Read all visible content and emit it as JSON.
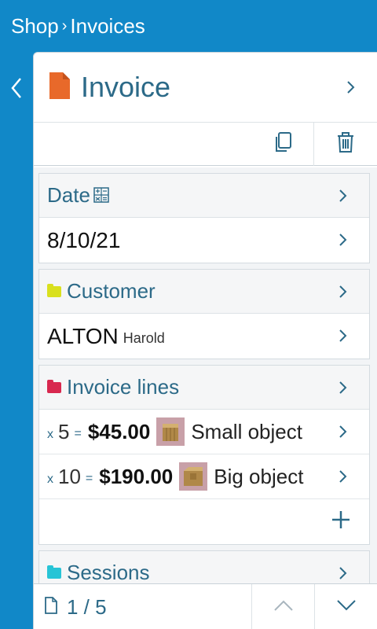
{
  "breadcrumb": {
    "parent": "Shop",
    "separator": "›",
    "current": "Invoices"
  },
  "header": {
    "title": "Invoice",
    "icon": "document-icon",
    "icon_color": "#e8692a"
  },
  "toolbar": {
    "copy_icon": "copy-icon",
    "delete_icon": "trash-icon"
  },
  "sections": {
    "date": {
      "label": "Date",
      "value": "8/10/21"
    },
    "customer": {
      "label": "Customer",
      "last_name": "ALTON",
      "first_name": "Harold",
      "folder_color": "#d9e01e"
    },
    "invoice_lines": {
      "label": "Invoice lines",
      "folder_color": "#d8284f",
      "lines": [
        {
          "x": "x",
          "qty": "5",
          "eq": "=",
          "price": "$45.00",
          "name": "Small object"
        },
        {
          "x": "x",
          "qty": "10",
          "eq": "=",
          "price": "$190.00",
          "name": "Big object"
        }
      ]
    },
    "sessions": {
      "label": "Sessions",
      "folder_color": "#27c4d6"
    }
  },
  "pager": {
    "text": "1 / 5"
  },
  "colors": {
    "background": "#1188c8",
    "accent": "#2c6a88"
  }
}
